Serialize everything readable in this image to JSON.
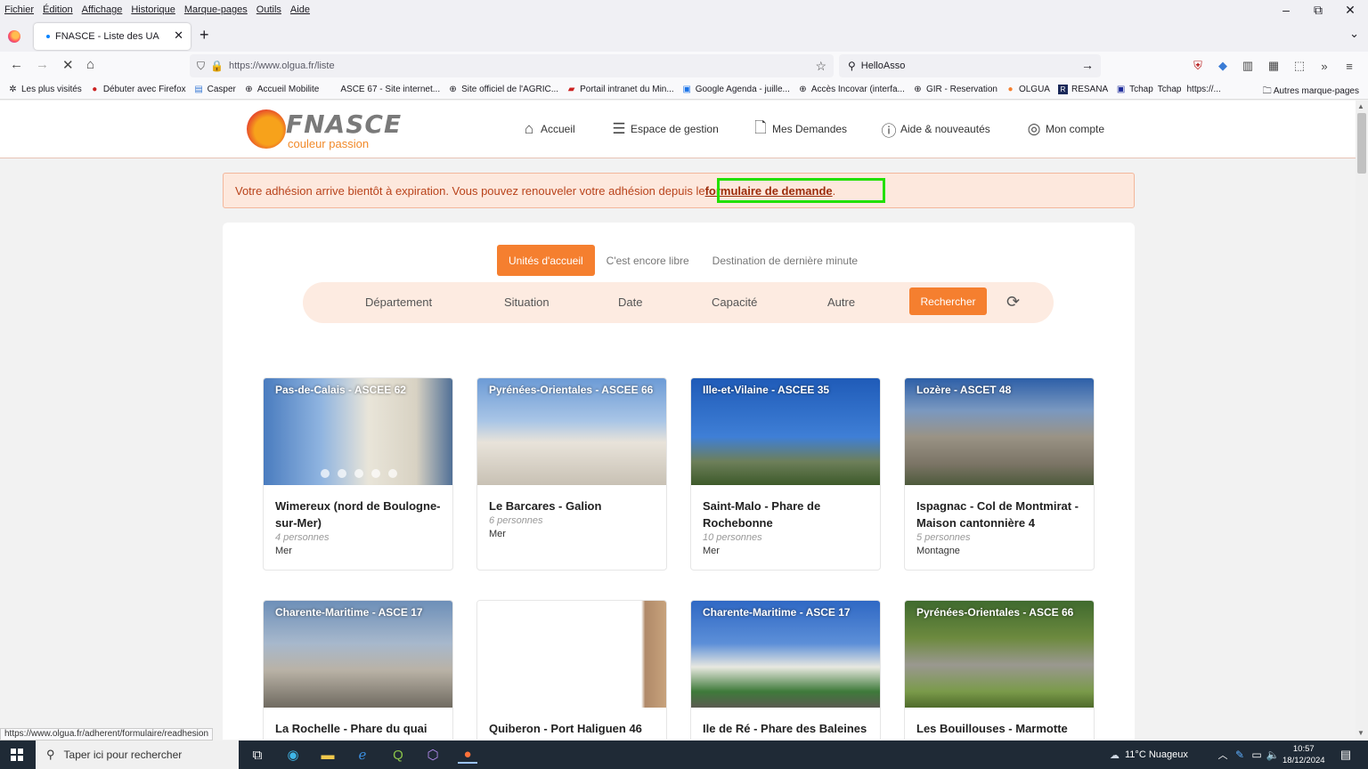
{
  "menubar": {
    "items": [
      "Fichier",
      "Édition",
      "Affichage",
      "Historique",
      "Marque-pages",
      "Outils",
      "Aide"
    ]
  },
  "window": {
    "minimize": "–",
    "restore": "⧉",
    "close": "✕"
  },
  "tab": {
    "title": "FNASCE - Liste des UA",
    "close": "✕",
    "new": "+",
    "list": "⌄"
  },
  "nav": {
    "url": "https://www.olgua.fr/liste",
    "search_value": "HelloAsso"
  },
  "bookmarks": {
    "items": [
      "Les plus visités",
      "Débuter avec Firefox",
      "Casper",
      "Accueil Mobilite",
      "ASCE 67 - Site internet...",
      "Site officiel de l'AGRIC...",
      "Portail intranet du Min...",
      "Google Agenda - juille...",
      "Accès Incovar (interfa...",
      "GIR - Reservation",
      "OLGUA",
      "RESANA",
      "Tchap",
      "Tchap",
      "https://..."
    ],
    "other": "Autres marque-pages"
  },
  "site": {
    "brand": "FNASCE",
    "tagline": "couleur passion",
    "nav": [
      "Accueil",
      "Espace de gestion",
      "Mes Demandes",
      "Aide & nouveautés",
      "Mon compte"
    ]
  },
  "alert": {
    "text": "Votre adhésion arrive bientôt à expiration. Vous pouvez renouveler votre adhésion depuis le ",
    "link": "formulaire de demande",
    "suffix": "."
  },
  "tabs": [
    "Unités d'accueil",
    "C'est encore libre",
    "Destination de dernière minute"
  ],
  "filters": [
    "Département",
    "Situation",
    "Date",
    "Capacité",
    "Autre"
  ],
  "search_button": "Rechercher",
  "cards": [
    {
      "region": "Pas-de-Calais - ASCEE 62",
      "title": "Wimereux (nord de Boulogne-sur-Mer)",
      "capacity": "4 personnes",
      "situation": "Mer"
    },
    {
      "region": "Pyrénées-Orientales - ASCEE 66",
      "title": "Le Barcares - Galion",
      "capacity": "6 personnes",
      "situation": "Mer"
    },
    {
      "region": "Ille-et-Vilaine - ASCEE 35",
      "title": "Saint-Malo - Phare de Rochebonne",
      "capacity": "10 personnes",
      "situation": "Mer"
    },
    {
      "region": "Lozère - ASCET 48",
      "title": "Ispagnac - Col de Montmirat - Maison cantonnière 4",
      "capacity": "5 personnes",
      "situation": "Montagne"
    },
    {
      "region": "Charente-Maritime - ASCE 17",
      "title": "La Rochelle - Phare du quai",
      "capacity": "",
      "situation": ""
    },
    {
      "region": "",
      "title": "Quiberon - Port Haliguen 46",
      "capacity": "",
      "situation": ""
    },
    {
      "region": "Charente-Maritime - ASCE 17",
      "title": "Ile de Ré - Phare des Baleines",
      "capacity": "",
      "situation": ""
    },
    {
      "region": "Pyrénées-Orientales - ASCE 66",
      "title": "Les Bouillouses - Marmotte",
      "capacity": "",
      "situation": ""
    }
  ],
  "status_url": "https://www.olgua.fr/adherent/formulaire/readhesion",
  "taskbar": {
    "search_placeholder": "Taper ici pour rechercher",
    "weather": "11°C  Nuageux",
    "time": "10:57",
    "date": "18/12/2024"
  },
  "colors": {
    "accent": "#f57f2f",
    "highlight": "#22e000",
    "alert_bg": "#fde8dd"
  }
}
